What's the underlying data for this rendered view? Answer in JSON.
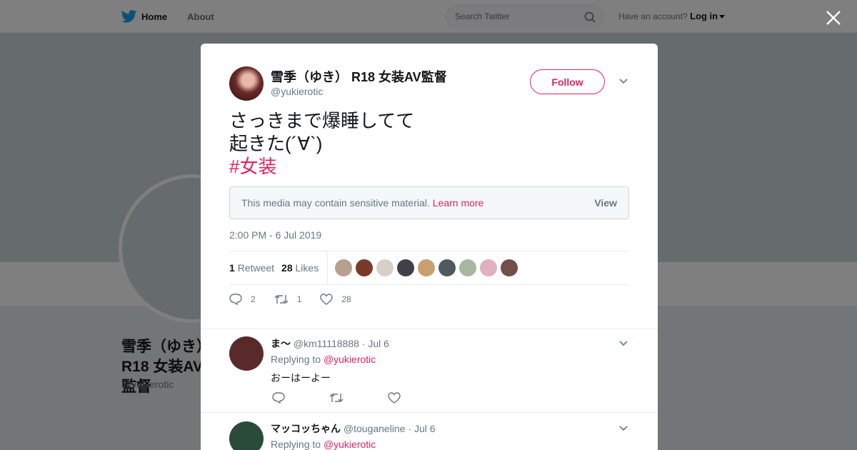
{
  "nav": {
    "home": "Home",
    "about": "About",
    "search_placeholder": "Search Twitter",
    "have_account": "Have an account?",
    "login": "Log in"
  },
  "background_profile": {
    "name": "雪季（ゆき）R18 女装AV監督",
    "handle": "@yukierotic"
  },
  "tweet": {
    "name": "雪季（ゆき） R18 女装AV監督",
    "handle": "@yukierotic",
    "follow_label": "Follow",
    "text_line1": "さっきまで爆睡してて",
    "text_line2": "起きた(´∀`)",
    "hashtag": "#女装",
    "sensitive_notice": "This media may contain sensitive material.",
    "learn_more": "Learn more",
    "view_label": "View",
    "timestamp": "2:00 PM - 6 Jul 2019",
    "retweet_count": "1",
    "retweet_label": "Retweet",
    "like_count": "28",
    "like_label": "Likes",
    "reply_action_count": "2",
    "retweet_action_count": "1",
    "like_action_count": "28"
  },
  "likers": [
    "#b8a090",
    "#7a3a2a",
    "#d8d0c8",
    "#404048",
    "#c8a070",
    "#505860",
    "#a8b8a0",
    "#e0b0c0",
    "#705048"
  ],
  "replies": [
    {
      "name": "ま～",
      "handle": "@km11118888",
      "date": "· Jul 6",
      "replying_to": "Replying to",
      "mention": "@yukierotic",
      "text": "おーはーよー",
      "avatar_color": "#5a2a2a"
    },
    {
      "name": "マッコッちゃん",
      "handle": "@touganeline",
      "date": "· Jul 6",
      "replying_to": "Replying to",
      "mention": "@yukierotic",
      "text": "",
      "avatar_color": "#2a4a3a"
    }
  ],
  "colors": {
    "accent": "#e0245e",
    "secondary_text": "#657786",
    "twitter_blue": "#1da1f2"
  }
}
